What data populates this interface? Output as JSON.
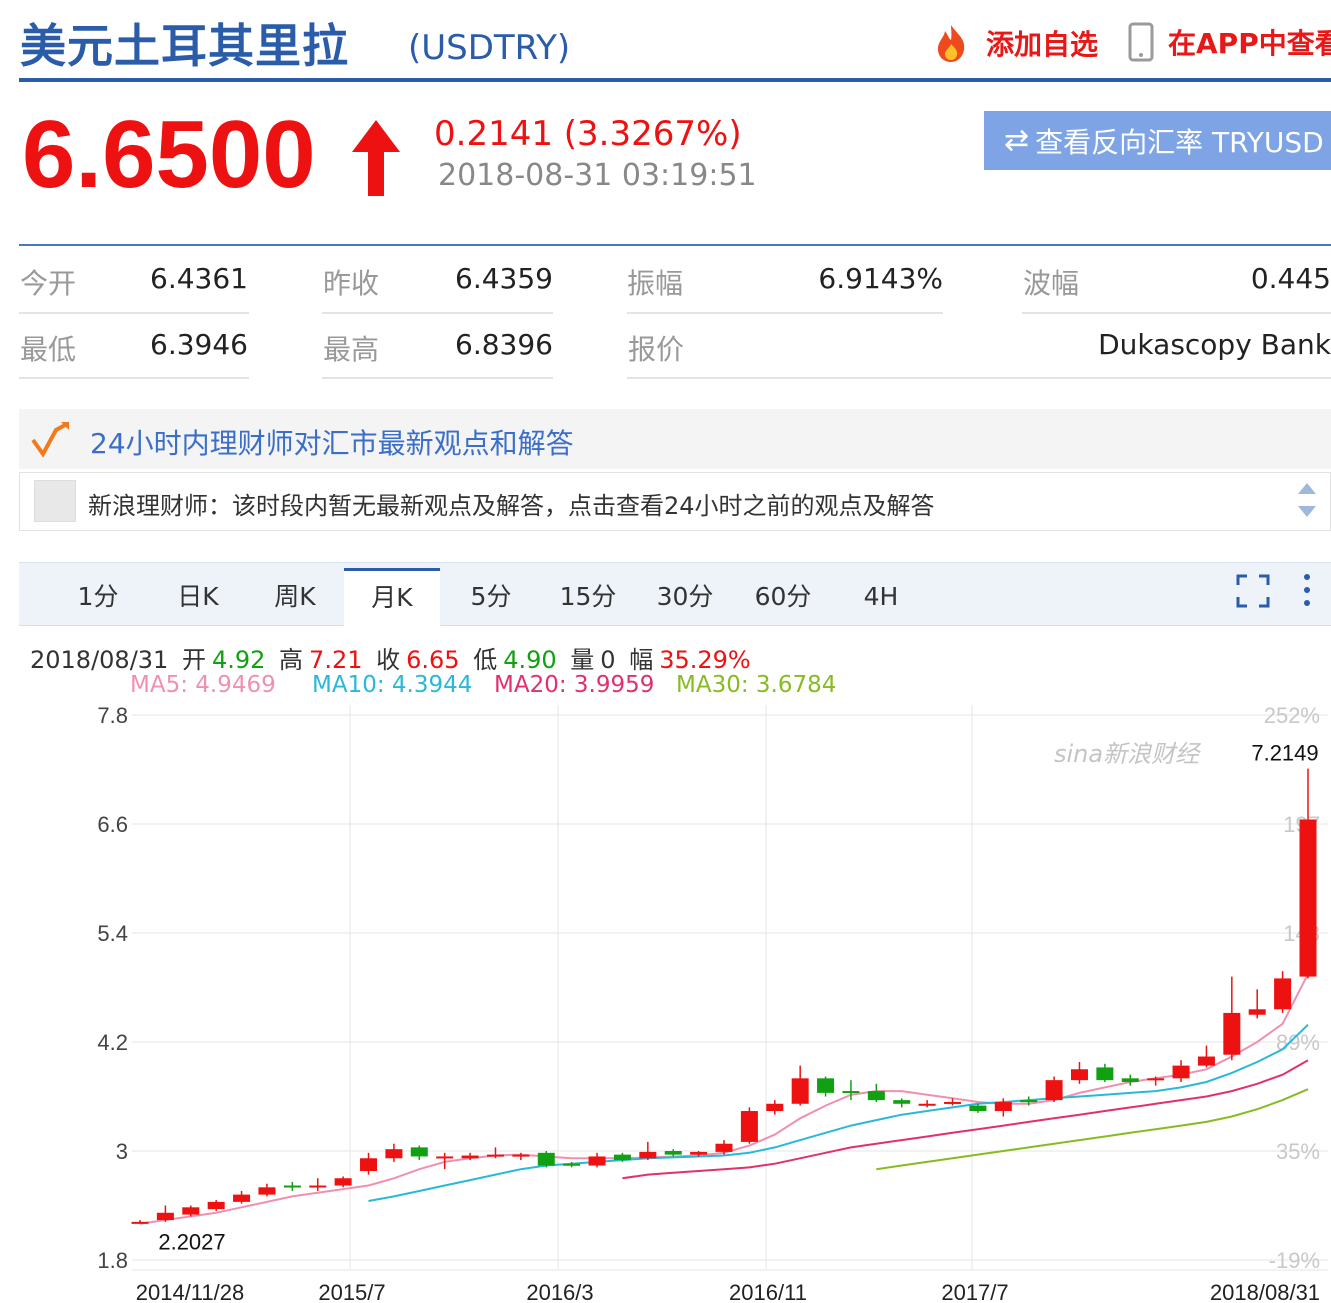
{
  "header": {
    "title": "美元土耳其里拉",
    "code": "(USDTRY)",
    "add_watch": "添加自选",
    "app_view": "在APP中查看"
  },
  "quote": {
    "price": "6.6500",
    "change": "0.2141 (3.3267%)",
    "timestamp": "2018-08-31 03:19:51",
    "reverse_button": "查看反向汇率 TRYUSD",
    "up_color": "#ee1111"
  },
  "stats": {
    "open_label": "今开",
    "open": "6.4361",
    "prev_close_label": "昨收",
    "prev_close": "6.4359",
    "amplitude_label": "振幅",
    "amplitude": "6.9143%",
    "wave_label": "波幅",
    "wave": "0.445",
    "low_label": "最低",
    "low": "6.3946",
    "high_label": "最高",
    "high": "6.8396",
    "quote_label": "报价",
    "quote_source": "Dukascopy Bank"
  },
  "advisor": {
    "title": "24小时内理财师对汇市最新观点和解答",
    "message": "新浪理财师：该时段内暂无最新观点及解答，点击查看24小时之前的观点及解答"
  },
  "tabs": [
    "1分",
    "日K",
    "周K",
    "月K",
    "5分",
    "15分",
    "30分",
    "60分",
    "4H"
  ],
  "active_tab": "月K",
  "ohlc": {
    "date": "2018/08/31",
    "open_label": "开",
    "open": "4.92",
    "high_label": "高",
    "high": "7.21",
    "close_label": "收",
    "close": "6.65",
    "low_label": "低",
    "low": "4.90",
    "vol_label": "量",
    "vol": "0",
    "range_label": "幅",
    "range": "35.29%"
  },
  "ma": {
    "ma5": "MA5: 4.9469",
    "ma10": "MA10: 4.3944",
    "ma20": "MA20: 3.9959",
    "ma30": "MA30: 3.6784"
  },
  "watermark": "sina新浪财经",
  "chart_data": {
    "type": "candlestick",
    "interval": "monthly",
    "ylim": [
      1.8,
      7.8
    ],
    "y_ticks": [
      "7.8",
      "6.6",
      "5.4",
      "4.2",
      "3",
      "1.8"
    ],
    "pct_ticks": [
      "252%",
      "197",
      "143",
      "89%",
      "35%",
      "-19%"
    ],
    "x_labels": [
      "2014/11/28",
      "2015/7",
      "2016/3",
      "2016/11",
      "2017/7",
      "2018/08/31"
    ],
    "annotations": {
      "max": "7.2149",
      "min": "2.2027"
    },
    "candles": [
      {
        "o": 2.2,
        "c": 2.22,
        "h": 2.24,
        "l": 2.2
      },
      {
        "o": 2.24,
        "c": 2.32,
        "h": 2.4,
        "l": 2.22
      },
      {
        "o": 2.3,
        "c": 2.38,
        "h": 2.4,
        "l": 2.28
      },
      {
        "o": 2.36,
        "c": 2.44,
        "h": 2.46,
        "l": 2.34
      },
      {
        "o": 2.44,
        "c": 2.52,
        "h": 2.56,
        "l": 2.42
      },
      {
        "o": 2.52,
        "c": 2.6,
        "h": 2.64,
        "l": 2.5
      },
      {
        "o": 2.62,
        "c": 2.6,
        "h": 2.66,
        "l": 2.56
      },
      {
        "o": 2.6,
        "c": 2.62,
        "h": 2.7,
        "l": 2.56
      },
      {
        "o": 2.62,
        "c": 2.7,
        "h": 2.72,
        "l": 2.6
      },
      {
        "o": 2.78,
        "c": 2.92,
        "h": 2.98,
        "l": 2.74
      },
      {
        "o": 2.92,
        "c": 3.02,
        "h": 3.08,
        "l": 2.88
      },
      {
        "o": 3.04,
        "c": 2.94,
        "h": 3.06,
        "l": 2.9
      },
      {
        "o": 2.94,
        "c": 2.94,
        "h": 2.98,
        "l": 2.8
      },
      {
        "o": 2.92,
        "c": 2.95,
        "h": 2.98,
        "l": 2.9
      },
      {
        "o": 2.94,
        "c": 2.96,
        "h": 3.04,
        "l": 2.92
      },
      {
        "o": 2.95,
        "c": 2.96,
        "h": 2.98,
        "l": 2.9
      },
      {
        "o": 2.98,
        "c": 2.84,
        "h": 3.0,
        "l": 2.82
      },
      {
        "o": 2.86,
        "c": 2.84,
        "h": 2.88,
        "l": 2.82
      },
      {
        "o": 2.84,
        "c": 2.94,
        "h": 2.98,
        "l": 2.82
      },
      {
        "o": 2.96,
        "c": 2.9,
        "h": 2.98,
        "l": 2.88
      },
      {
        "o": 2.92,
        "c": 2.99,
        "h": 3.1,
        "l": 2.9
      },
      {
        "o": 3.0,
        "c": 2.96,
        "h": 3.02,
        "l": 2.94
      },
      {
        "o": 2.96,
        "c": 2.99,
        "h": 3.0,
        "l": 2.94
      },
      {
        "o": 2.99,
        "c": 3.08,
        "h": 3.12,
        "l": 2.96
      },
      {
        "o": 3.1,
        "c": 3.44,
        "h": 3.48,
        "l": 3.08
      },
      {
        "o": 3.44,
        "c": 3.52,
        "h": 3.56,
        "l": 3.4
      },
      {
        "o": 3.52,
        "c": 3.8,
        "h": 3.94,
        "l": 3.5
      },
      {
        "o": 3.8,
        "c": 3.64,
        "h": 3.82,
        "l": 3.6
      },
      {
        "o": 3.66,
        "c": 3.64,
        "h": 3.78,
        "l": 3.56
      },
      {
        "o": 3.66,
        "c": 3.56,
        "h": 3.74,
        "l": 3.54
      },
      {
        "o": 3.56,
        "c": 3.52,
        "h": 3.58,
        "l": 3.48
      },
      {
        "o": 3.52,
        "c": 3.52,
        "h": 3.56,
        "l": 3.48
      },
      {
        "o": 3.52,
        "c": 3.54,
        "h": 3.58,
        "l": 3.5
      },
      {
        "o": 3.5,
        "c": 3.44,
        "h": 3.52,
        "l": 3.42
      },
      {
        "o": 3.44,
        "c": 3.54,
        "h": 3.58,
        "l": 3.38
      },
      {
        "o": 3.56,
        "c": 3.54,
        "h": 3.6,
        "l": 3.5
      },
      {
        "o": 3.56,
        "c": 3.78,
        "h": 3.82,
        "l": 3.54
      },
      {
        "o": 3.78,
        "c": 3.9,
        "h": 3.98,
        "l": 3.74
      },
      {
        "o": 3.92,
        "c": 3.78,
        "h": 3.96,
        "l": 3.76
      },
      {
        "o": 3.8,
        "c": 3.76,
        "h": 3.84,
        "l": 3.72
      },
      {
        "o": 3.78,
        "c": 3.8,
        "h": 3.82,
        "l": 3.72
      },
      {
        "o": 3.8,
        "c": 3.94,
        "h": 4.0,
        "l": 3.76
      },
      {
        "o": 3.94,
        "c": 4.04,
        "h": 4.16,
        "l": 3.92
      },
      {
        "o": 4.06,
        "c": 4.52,
        "h": 4.92,
        "l": 4.0
      },
      {
        "o": 4.5,
        "c": 4.56,
        "h": 4.78,
        "l": 4.46
      },
      {
        "o": 4.56,
        "c": 4.9,
        "h": 4.98,
        "l": 4.52
      },
      {
        "o": 4.92,
        "c": 6.65,
        "h": 7.21,
        "l": 4.9
      }
    ],
    "ma_series": [
      {
        "name": "MA5",
        "color": "#f090b0",
        "values": [
          2.2,
          2.24,
          2.28,
          2.32,
          2.38,
          2.44,
          2.5,
          2.54,
          2.58,
          2.62,
          2.7,
          2.8,
          2.88,
          2.92,
          2.95,
          2.96,
          2.94,
          2.92,
          2.92,
          2.92,
          2.93,
          2.94,
          2.95,
          2.98,
          3.06,
          3.18,
          3.36,
          3.5,
          3.62,
          3.66,
          3.66,
          3.62,
          3.58,
          3.54,
          3.52,
          3.52,
          3.56,
          3.64,
          3.7,
          3.76,
          3.8,
          3.84,
          3.9,
          4.04,
          4.2,
          4.4,
          4.95
        ]
      },
      {
        "name": "MA10",
        "color": "#2ab8d8",
        "values": [
          null,
          null,
          null,
          null,
          null,
          null,
          null,
          null,
          null,
          2.45,
          2.5,
          2.56,
          2.62,
          2.68,
          2.74,
          2.8,
          2.84,
          2.86,
          2.88,
          2.9,
          2.92,
          2.93,
          2.94,
          2.95,
          2.98,
          3.04,
          3.12,
          3.2,
          3.28,
          3.34,
          3.4,
          3.44,
          3.48,
          3.52,
          3.54,
          3.56,
          3.58,
          3.6,
          3.62,
          3.64,
          3.66,
          3.7,
          3.76,
          3.86,
          3.98,
          4.12,
          4.39
        ]
      },
      {
        "name": "MA20",
        "color": "#e03070",
        "values": [
          null,
          null,
          null,
          null,
          null,
          null,
          null,
          null,
          null,
          null,
          null,
          null,
          null,
          null,
          null,
          null,
          null,
          null,
          null,
          2.7,
          2.74,
          2.76,
          2.78,
          2.8,
          2.82,
          2.86,
          2.92,
          2.98,
          3.04,
          3.08,
          3.12,
          3.16,
          3.2,
          3.24,
          3.28,
          3.32,
          3.36,
          3.4,
          3.44,
          3.48,
          3.52,
          3.56,
          3.6,
          3.66,
          3.74,
          3.84,
          4.0
        ]
      },
      {
        "name": "MA30",
        "color": "#88bb22",
        "values": [
          null,
          null,
          null,
          null,
          null,
          null,
          null,
          null,
          null,
          null,
          null,
          null,
          null,
          null,
          null,
          null,
          null,
          null,
          null,
          null,
          null,
          null,
          null,
          null,
          null,
          null,
          null,
          null,
          null,
          2.8,
          2.84,
          2.88,
          2.92,
          2.96,
          3.0,
          3.04,
          3.08,
          3.12,
          3.16,
          3.2,
          3.24,
          3.28,
          3.32,
          3.38,
          3.46,
          3.56,
          3.68
        ]
      }
    ],
    "colors": {
      "up": "#ee1111",
      "down": "#11a011"
    }
  }
}
